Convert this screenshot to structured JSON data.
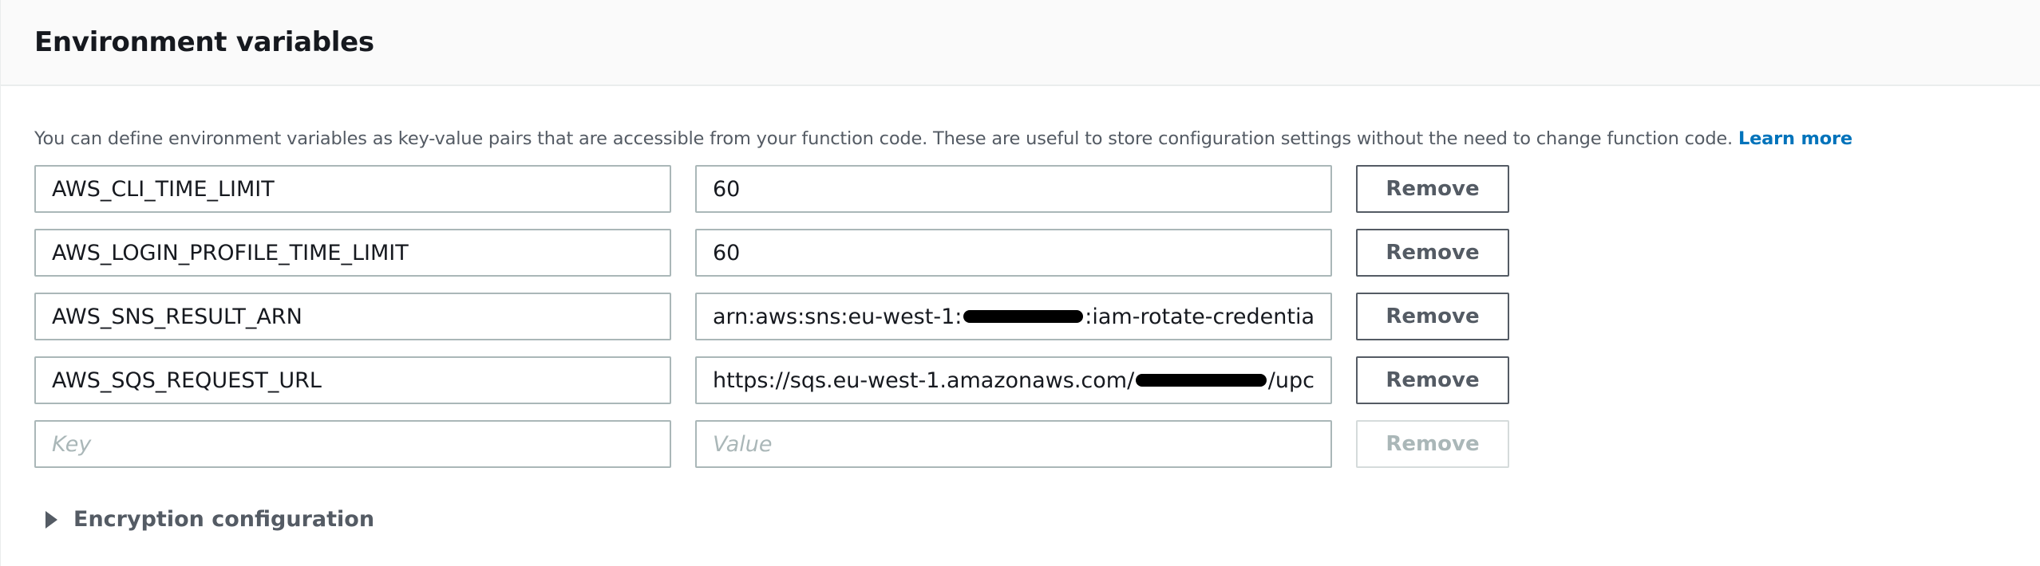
{
  "header": {
    "title": "Environment variables"
  },
  "description": {
    "text": "You can define environment variables as key-value pairs that are accessible from your function code. These are useful to store configuration settings without the need to change function code. ",
    "link_label": "Learn more"
  },
  "rows": [
    {
      "key": "AWS_CLI_TIME_LIMIT",
      "value": "60",
      "button": "Remove"
    },
    {
      "key": "AWS_LOGIN_PROFILE_TIME_LIMIT",
      "value": "60",
      "button": "Remove"
    },
    {
      "key": "AWS_SNS_RESULT_ARN",
      "value_prefix": "arn:aws:sns:eu-west-1:",
      "value_suffix": ":iam-rotate-credentia",
      "button": "Remove"
    },
    {
      "key": "AWS_SQS_REQUEST_URL",
      "value_prefix": "https://sqs.eu-west-1.amazonaws.com/",
      "value_suffix": "/upc",
      "button": "Remove"
    }
  ],
  "new_row": {
    "key_placeholder": "Key",
    "value_placeholder": "Value",
    "button": "Remove"
  },
  "encryption": {
    "label": "Encryption configuration",
    "icon": "caret-right-icon"
  },
  "colors": {
    "link": "#0073bb",
    "text_secondary": "#545b64",
    "input_border": "#aab7b8",
    "header_bg": "#fafafa"
  }
}
